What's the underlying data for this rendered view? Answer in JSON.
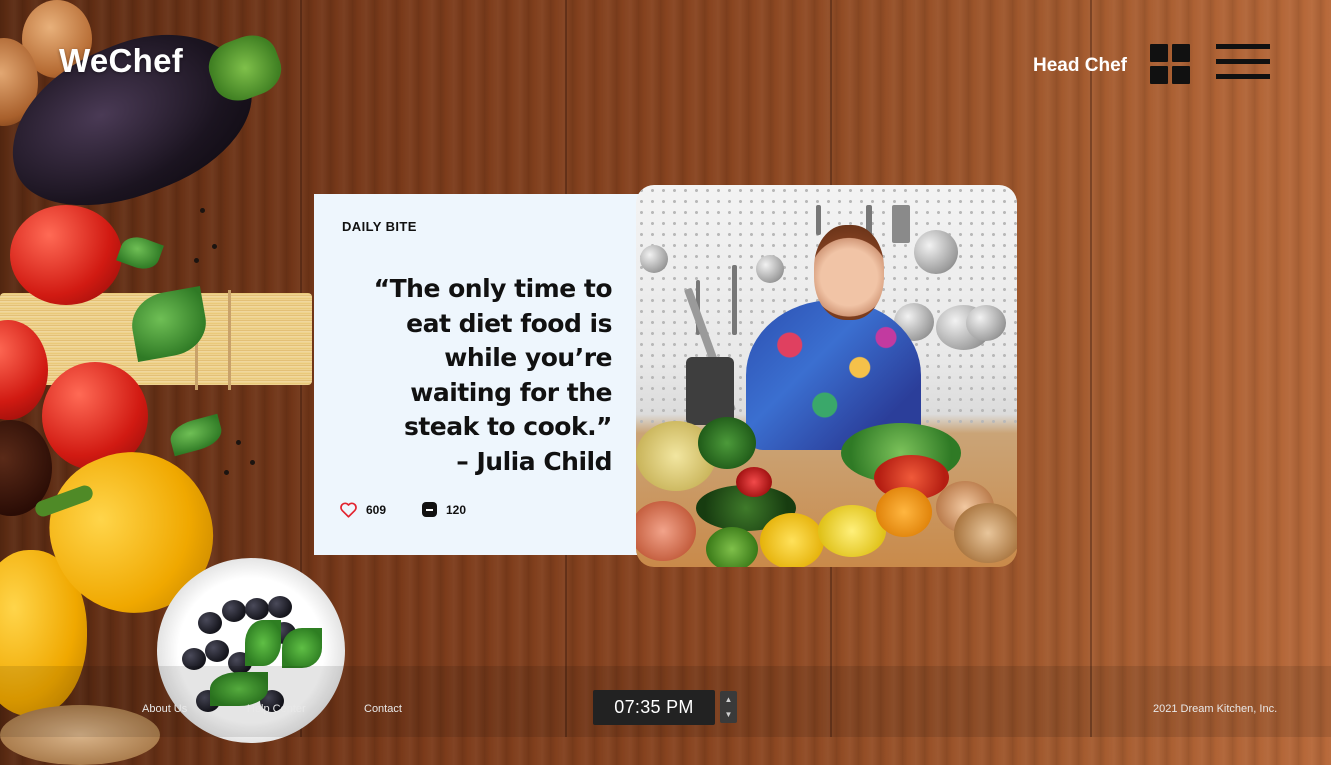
{
  "header": {
    "logo": "WeChef",
    "user_name": "Head Chef",
    "icons": [
      "grid-icon",
      "menu-icon"
    ]
  },
  "card": {
    "label": "DAILY BITE",
    "quote_lines": [
      "“The only time to",
      "eat diet food is",
      "while you’re",
      "waiting for the",
      "steak to cook.”",
      "– Julia Child"
    ],
    "likes": "609",
    "comments": "120",
    "photo_subject": "Julia Child in kitchen with vegetables"
  },
  "footer": {
    "links": [
      "About Us",
      "Help Center",
      "Contact"
    ],
    "time": "07:35 PM",
    "copyright": "2021 Dream Kitchen, Inc."
  },
  "colors": {
    "card_background": "#eef6fd",
    "text_dark": "#111111",
    "heart_icon": "#e2232f",
    "clock_background": "#222222"
  }
}
